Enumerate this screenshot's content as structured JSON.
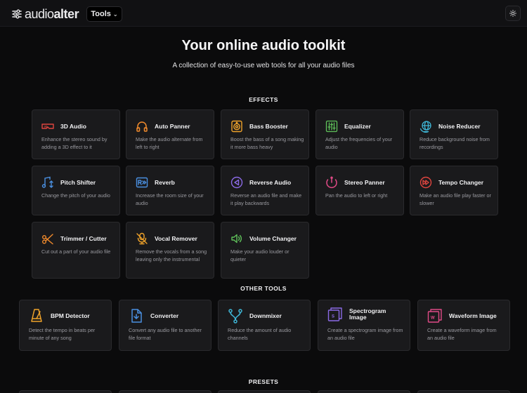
{
  "header": {
    "logo_text_light": "audio",
    "logo_text_bold": "alter",
    "tools_label": "Tools",
    "theme_icon": "sun-icon"
  },
  "hero": {
    "title": "Your online audio toolkit",
    "subtitle": "A collection of easy-to-use web tools for all your audio files"
  },
  "sections": {
    "effects": "EFFECTS",
    "other": "OTHER TOOLS",
    "presets": "PRESETS"
  },
  "effects": [
    {
      "name": "3D Audio",
      "desc": "Enhance the stereo sound by adding a 3D effect to it",
      "icon": "3d-glasses-icon",
      "color": "#e0453f"
    },
    {
      "name": "Auto Panner",
      "desc": "Make the audio alternate from left to right",
      "icon": "headphones-icon",
      "color": "#f08a2c"
    },
    {
      "name": "Bass Booster",
      "desc": "Boost the bass of a song making it more bass heavy",
      "icon": "speaker-icon",
      "color": "#f0a32a"
    },
    {
      "name": "Equalizer",
      "desc": "Adjust the frequencies of your audio",
      "icon": "sliders-icon",
      "color": "#5fc25a"
    },
    {
      "name": "Noise Reducer",
      "desc": "Reduce background noise from recordings",
      "icon": "globe-icon",
      "color": "#3fb6d6"
    },
    {
      "name": "Pitch Shifter",
      "desc": "Change the pitch of your audio",
      "icon": "music-note-icon",
      "color": "#4a8fe0"
    },
    {
      "name": "Reverb",
      "desc": "Increase the room size of your audio",
      "icon": "reverb-icon",
      "color": "#4a8fe0"
    },
    {
      "name": "Reverse Audio",
      "desc": "Reverse an audio file and make it play backwards",
      "icon": "reverse-icon",
      "color": "#8b6ae6"
    },
    {
      "name": "Stereo Panner",
      "desc": "Pan the audio to left or right",
      "icon": "pan-dial-icon",
      "color": "#e04a86"
    },
    {
      "name": "Tempo Changer",
      "desc": "Make an audio file play faster or slower",
      "icon": "fast-forward-icon",
      "color": "#e0453f"
    },
    {
      "name": "Trimmer / Cutter",
      "desc": "Cut out a part of your audio file",
      "icon": "scissors-icon",
      "color": "#f08a2c"
    },
    {
      "name": "Vocal Remover",
      "desc": "Remove the vocals from a song leaving only the instrumental",
      "icon": "microphone-icon",
      "color": "#f0a32a"
    },
    {
      "name": "Volume Changer",
      "desc": "Make your audio louder or quieter",
      "icon": "volume-icon",
      "color": "#5fc25a"
    }
  ],
  "other_tools": [
    {
      "name": "BPM Detector",
      "desc": "Detect the tempo in beats per minute of any song",
      "icon": "metronome-icon",
      "color": "#f0a32a"
    },
    {
      "name": "Converter",
      "desc": "Convert any audio file to another file format",
      "icon": "file-convert-icon",
      "color": "#4a8fe0"
    },
    {
      "name": "Downmixer",
      "desc": "Reduce the amount of audio channels",
      "icon": "downmix-icon",
      "color": "#3fb6d6"
    },
    {
      "name": "Spectrogram Image",
      "desc": "Create a spectrogram image from an audio file",
      "icon": "spectrogram-icon",
      "color": "#8b6ae6"
    },
    {
      "name": "Waveform Image",
      "desc": "Create a waveform image from an audio file",
      "icon": "waveform-icon",
      "color": "#e04a86"
    }
  ]
}
